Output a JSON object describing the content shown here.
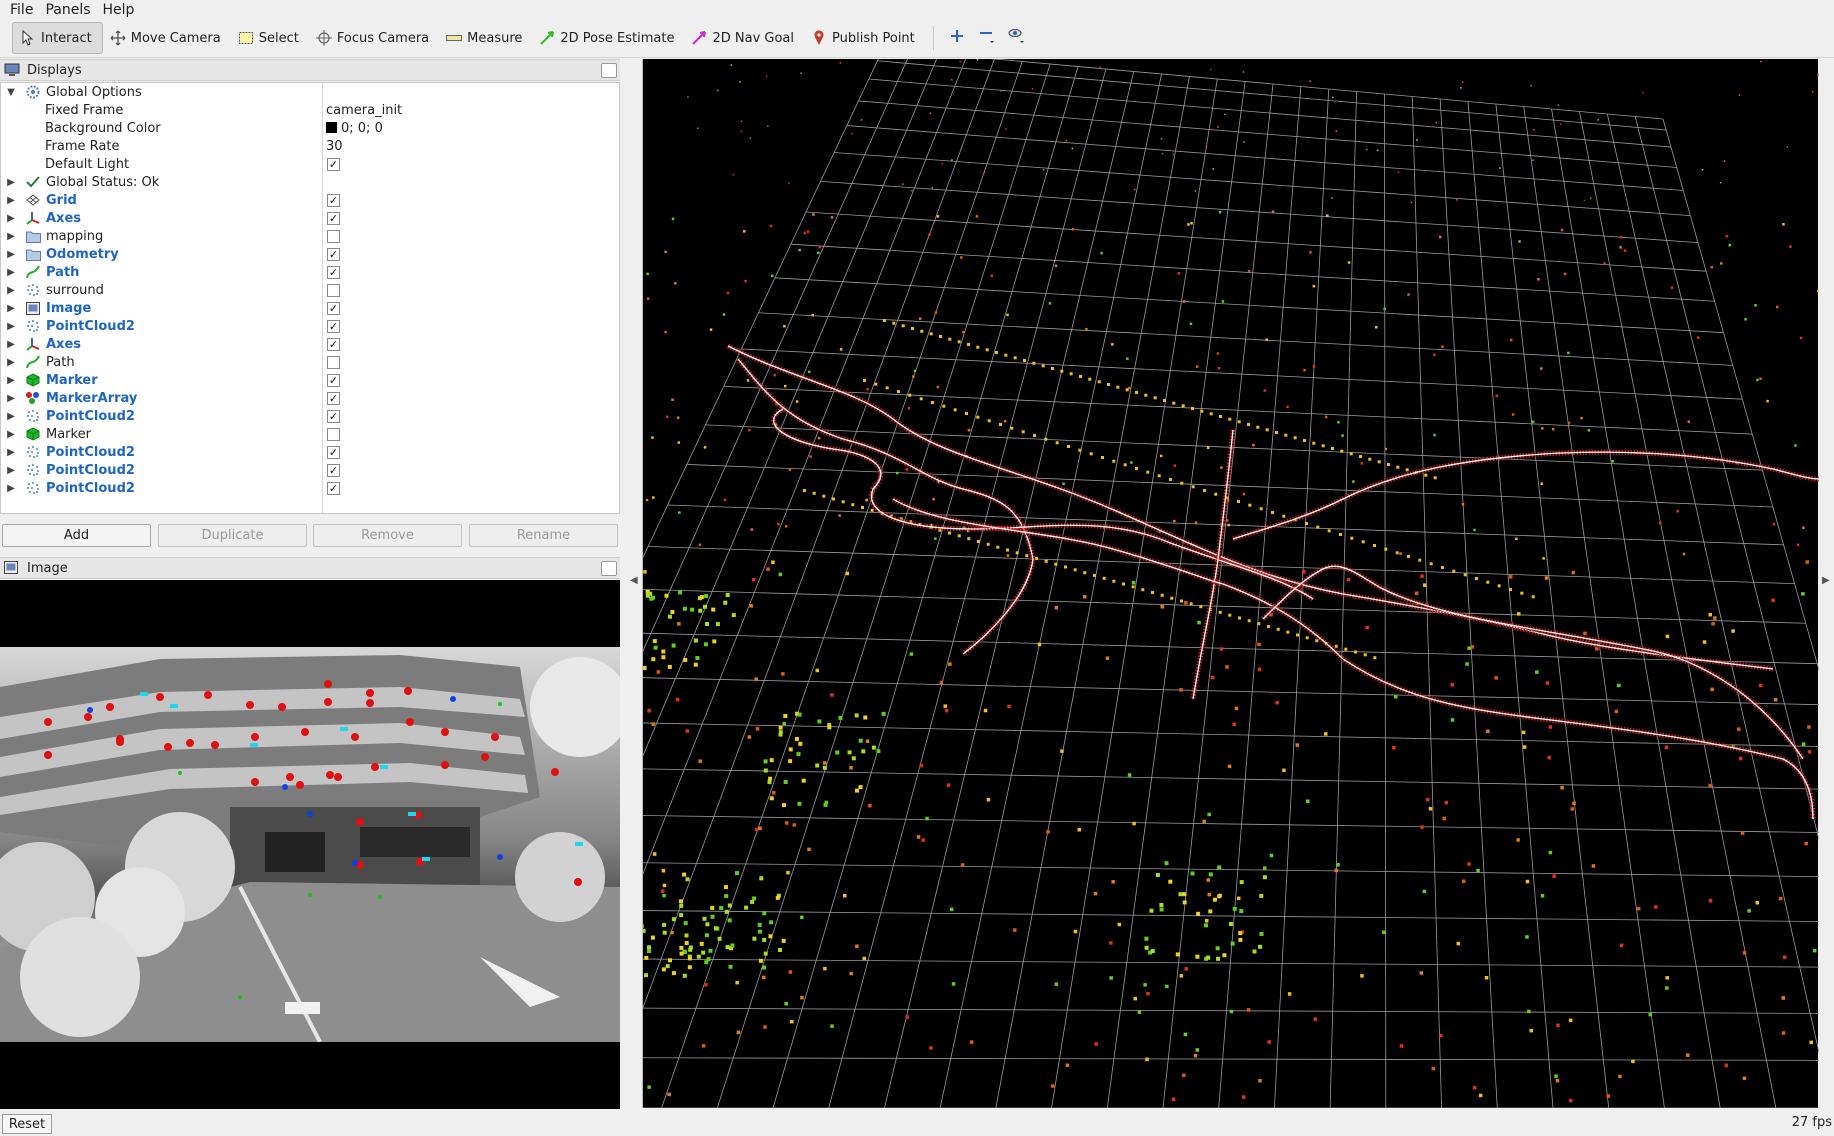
{
  "menubar": {
    "items": [
      "File",
      "Panels",
      "Help"
    ]
  },
  "toolbar": {
    "tools": [
      {
        "label": "Interact",
        "icon": "cursor-icon",
        "active": true
      },
      {
        "label": "Move Camera",
        "icon": "move-camera-icon"
      },
      {
        "label": "Select",
        "icon": "select-icon"
      },
      {
        "label": "Focus Camera",
        "icon": "focus-camera-icon"
      },
      {
        "label": "Measure",
        "icon": "measure-icon"
      },
      {
        "label": "2D Pose Estimate",
        "icon": "pose-estimate-icon",
        "color": "#2bbd2b"
      },
      {
        "label": "2D Nav Goal",
        "icon": "nav-goal-icon",
        "color": "#d02bd0"
      },
      {
        "label": "Publish Point",
        "icon": "publish-point-icon",
        "color": "#c43b2a"
      }
    ]
  },
  "displays_panel": {
    "title": "Displays",
    "global_options": {
      "label": "Global Options",
      "fixed_frame_label": "Fixed Frame",
      "fixed_frame_value": "camera_init",
      "background_color_label": "Background Color",
      "background_color_value": "0; 0; 0",
      "frame_rate_label": "Frame Rate",
      "frame_rate_value": "30",
      "default_light_label": "Default Light",
      "default_light_checked": true
    },
    "global_status": "Global Status: Ok",
    "displays": [
      {
        "name": "Grid",
        "icon": "grid-icon",
        "checked": true,
        "enabled": true
      },
      {
        "name": "Axes",
        "icon": "axes-icon",
        "checked": true,
        "enabled": true
      },
      {
        "name": "mapping",
        "icon": "folder-icon",
        "checked": false,
        "enabled": false
      },
      {
        "name": "Odometry",
        "icon": "folder-icon",
        "checked": true,
        "enabled": true
      },
      {
        "name": "Path",
        "icon": "path-icon",
        "checked": true,
        "enabled": true
      },
      {
        "name": "surround",
        "icon": "pointcloud-icon",
        "checked": false,
        "enabled": false
      },
      {
        "name": "Image",
        "icon": "image-icon",
        "checked": true,
        "enabled": true
      },
      {
        "name": "PointCloud2",
        "icon": "pointcloud-icon",
        "checked": true,
        "enabled": true
      },
      {
        "name": "Axes",
        "icon": "axes-icon",
        "checked": true,
        "enabled": true
      },
      {
        "name": "Path",
        "icon": "path-icon",
        "checked": false,
        "enabled": false
      },
      {
        "name": "Marker",
        "icon": "marker-icon",
        "checked": true,
        "enabled": true
      },
      {
        "name": "MarkerArray",
        "icon": "marker-array-icon",
        "checked": true,
        "enabled": true
      },
      {
        "name": "PointCloud2",
        "icon": "pointcloud-icon",
        "checked": true,
        "enabled": true
      },
      {
        "name": "Marker",
        "icon": "marker-icon",
        "checked": false,
        "enabled": false
      },
      {
        "name": "PointCloud2",
        "icon": "pointcloud-icon",
        "checked": true,
        "enabled": true
      },
      {
        "name": "PointCloud2",
        "icon": "pointcloud-icon",
        "checked": true,
        "enabled": true
      },
      {
        "name": "PointCloud2",
        "icon": "pointcloud-icon",
        "checked": true,
        "enabled": true
      }
    ],
    "buttons": {
      "add": "Add",
      "duplicate": "Duplicate",
      "remove": "Remove",
      "rename": "Rename"
    }
  },
  "image_panel": {
    "title": "Image"
  },
  "statusbar": {
    "reset": "Reset",
    "fps": "27 fps"
  },
  "colors": {
    "display_enabled": "#1f66c2",
    "trajectory_red": "#d01818",
    "trajectory_white": "#ffffff",
    "grid_line": "#9a9a9a",
    "view_background": "#000000"
  }
}
